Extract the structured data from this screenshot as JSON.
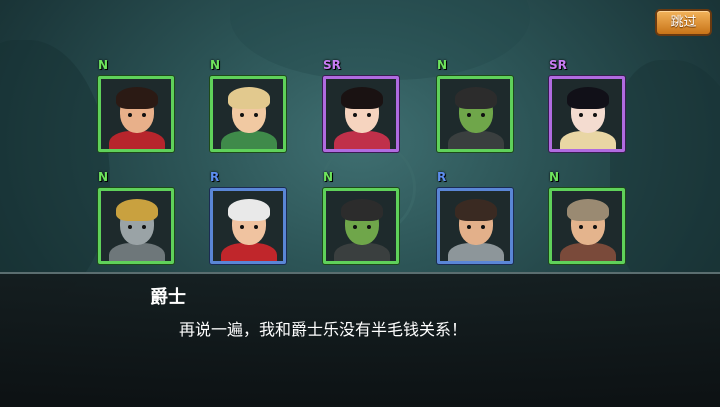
{
  "ui": {
    "skip_label": "跳过"
  },
  "dialog": {
    "speaker": "爵士",
    "text": "再说一遍，我和爵士乐没有半毛钱关系！"
  },
  "roster": [
    {
      "rarity": "N",
      "character": "mustached-noble",
      "colors": {
        "skin": "#e8b08a",
        "hair": "#2b1a14",
        "outfit": "#b7252c"
      }
    },
    {
      "rarity": "N",
      "character": "blonde-elf",
      "colors": {
        "skin": "#f1c9a2",
        "hair": "#e2c98e",
        "outfit": "#3f8a4a"
      }
    },
    {
      "rarity": "SR",
      "character": "princess",
      "colors": {
        "skin": "#f6d4bf",
        "hair": "#1a1212",
        "outfit": "#c0304a"
      }
    },
    {
      "rarity": "N",
      "character": "goblin",
      "colors": {
        "skin": "#6fa64a",
        "hair": "#2c2c2c",
        "outfit": "#3a3f3f"
      }
    },
    {
      "rarity": "SR",
      "character": "dark-haired-girl",
      "colors": {
        "skin": "#f4dcd0",
        "hair": "#111018",
        "outfit": "#e9d6a4"
      }
    },
    {
      "rarity": "N",
      "character": "armored-knight",
      "colors": {
        "skin": "#9aa3a6",
        "hair": "#c9a13f",
        "outfit": "#6e777a"
      }
    },
    {
      "rarity": "R",
      "character": "bearded-king",
      "colors": {
        "skin": "#f0c3a0",
        "hair": "#e9e9e9",
        "outfit": "#c0262b"
      }
    },
    {
      "rarity": "N",
      "character": "goblin",
      "colors": {
        "skin": "#6fa64a",
        "hair": "#2c2c2c",
        "outfit": "#3a3f3f"
      }
    },
    {
      "rarity": "R",
      "character": "soldier",
      "colors": {
        "skin": "#e3b08a",
        "hair": "#3a2a22",
        "outfit": "#8d969a"
      }
    },
    {
      "rarity": "N",
      "character": "helmeted-warrior",
      "colors": {
        "skin": "#e4b48d",
        "hair": "#9a8a72",
        "outfit": "#7a4a3a"
      }
    }
  ]
}
